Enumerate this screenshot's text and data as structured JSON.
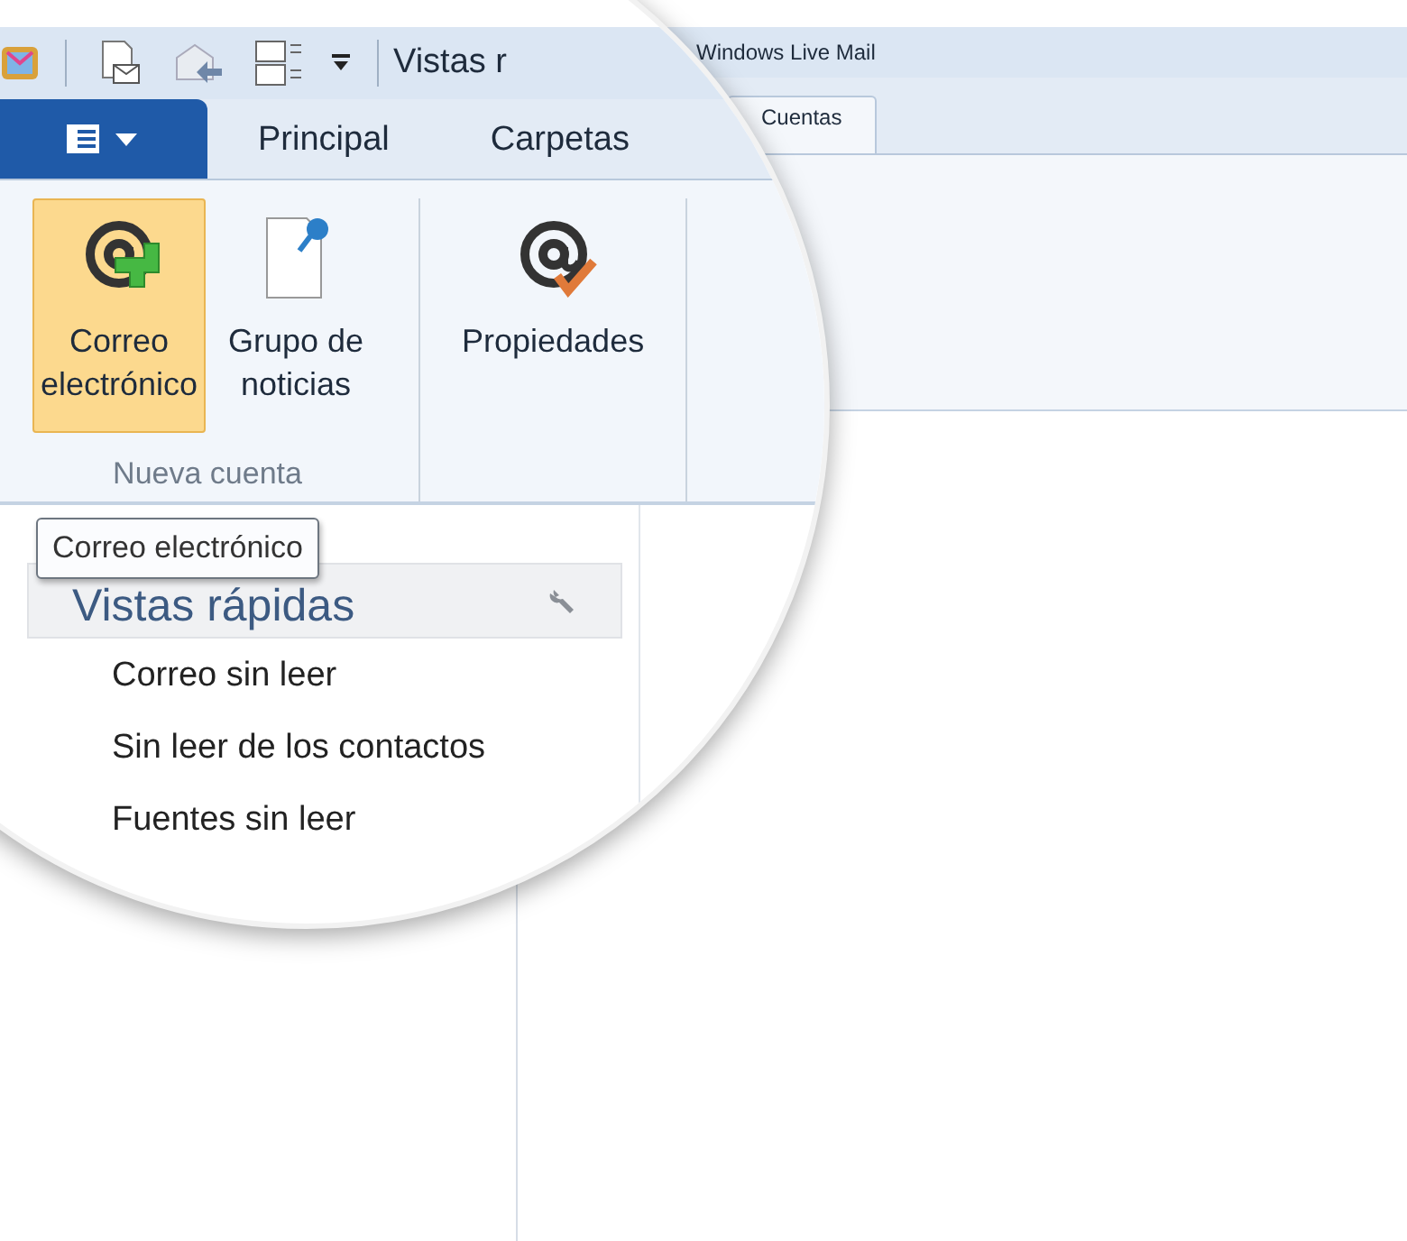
{
  "window": {
    "title_magnified": "Vistas r",
    "title": "Windows Live Mail"
  },
  "ribbon_tabs": [
    {
      "label": "Principal",
      "selected": false
    },
    {
      "label": "Carpetas",
      "selected": false
    },
    {
      "label": "Cuentas",
      "selected": true
    }
  ],
  "ribbon_groups": [
    {
      "label": "Nueva cuenta",
      "buttons": [
        {
          "label": "Correo electrónico",
          "kind": "add-mail",
          "highlighted": true
        },
        {
          "label": "Grupo de noticias",
          "kind": "newsgroup",
          "highlighted": false
        }
      ]
    },
    {
      "buttons": [
        {
          "label": "Propiedades",
          "kind": "properties",
          "highlighted": false
        }
      ]
    }
  ],
  "tooltip": "Correo electrónico",
  "sidebar": {
    "header": "Vistas rápidas",
    "items": [
      "Correo sin leer",
      "Sin leer de los contactos",
      "Fuentes sin leer"
    ]
  }
}
